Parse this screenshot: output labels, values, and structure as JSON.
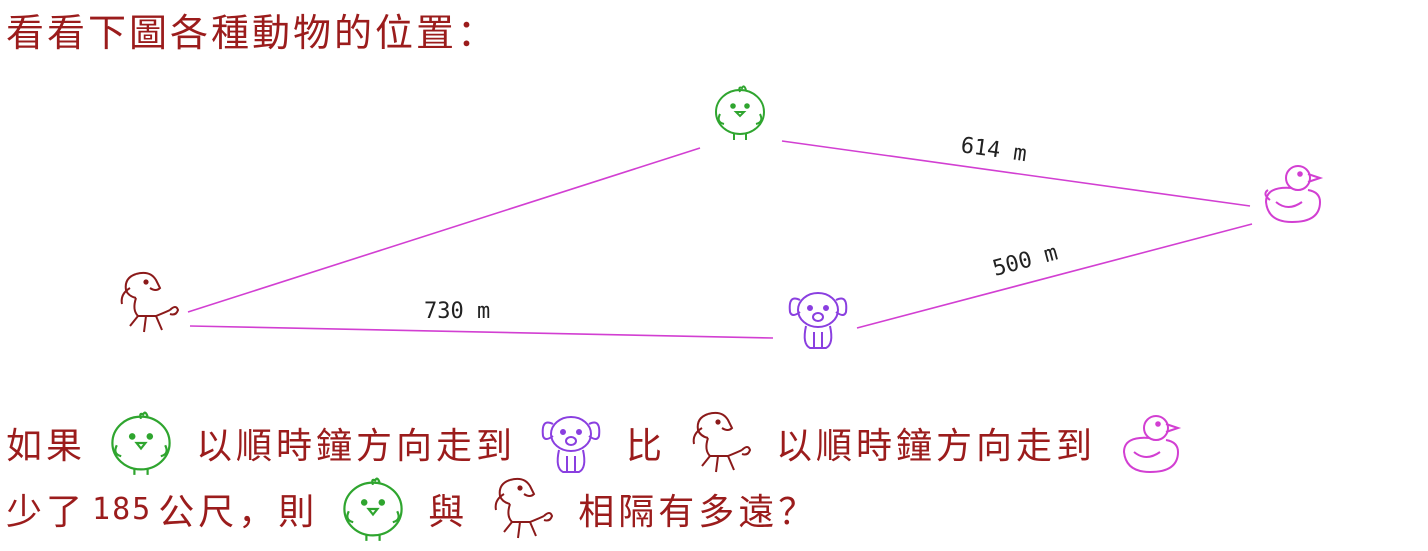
{
  "title": "看看下圖各種動物的位置：",
  "icons": {
    "chick": "chick-icon",
    "duck": "duck-icon",
    "dog": "dog-icon",
    "horse": "horse-icon"
  },
  "colors": {
    "text": "#9b1c1c",
    "line": "#d23fd2",
    "chick": "#2fa52f",
    "duck": "#d23fd2",
    "dog": "#8a3fe0",
    "horse": "#8b1a1a"
  },
  "distances": {
    "chick_duck": "614 m",
    "dog_duck": "500 m",
    "horse_dog": "730 m"
  },
  "question": {
    "p1": "如果",
    "p2": "以順時鐘方向走到",
    "p3": "比",
    "p4": "以順時鐘方向走到",
    "p5": "少了",
    "num": "185",
    "p6": "公尺，則",
    "p7": "與",
    "p8": "相隔有多遠？"
  }
}
